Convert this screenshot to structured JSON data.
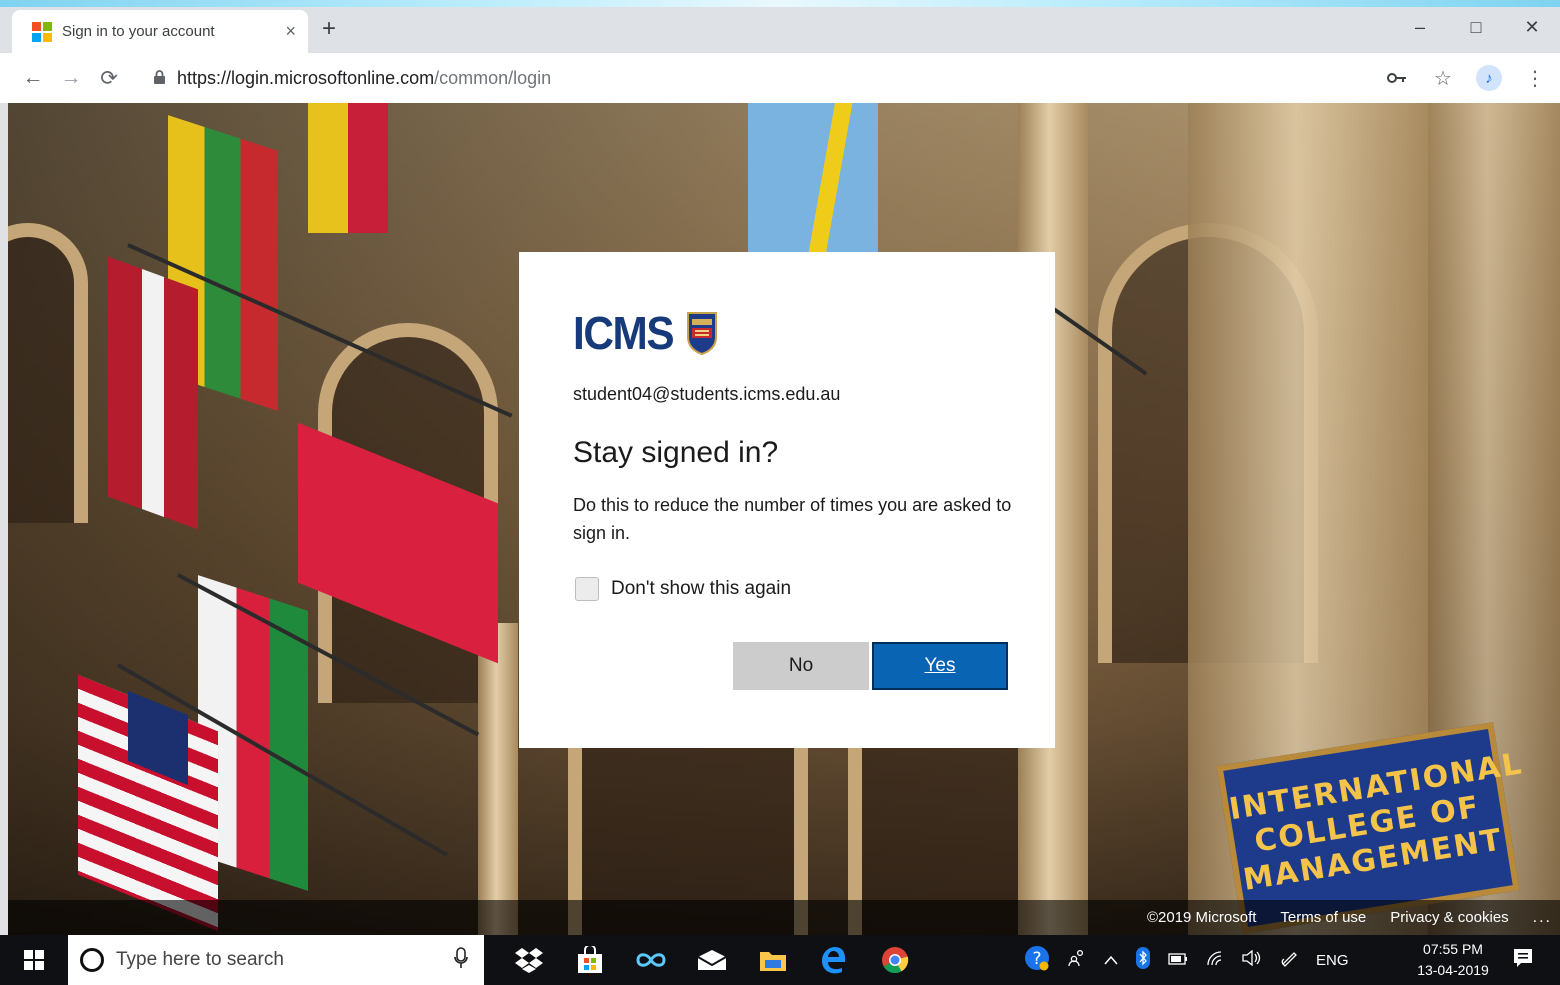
{
  "browser": {
    "tab_title": "Sign in to your account",
    "tab_close": "×",
    "new_tab": "+",
    "window_controls": {
      "minimize": "–",
      "maximize": "□",
      "close": "✕"
    },
    "nav": {
      "back": "←",
      "forward": "→",
      "reload": "⟳"
    },
    "url_host": "https://login.microsoftonline.com",
    "url_path": "/common/login",
    "toolbar_icons": [
      "key-icon",
      "star-icon",
      "profile-icon",
      "menu-icon"
    ],
    "star": "☆",
    "menu": "⋮",
    "key": "⚿",
    "profile_initial": "♪"
  },
  "background": {
    "plaque_text": "INTERNATIONAL COLLEGE OF MANAGEMENT"
  },
  "dialog": {
    "brand": "ICMS",
    "identity": "student04@students.icms.edu.au",
    "heading": "Stay signed in?",
    "description": "Do this to reduce the number of times you are asked to sign in.",
    "checkbox_label": "Don't show this again",
    "checkbox_checked": false,
    "no_label": "No",
    "yes_label": "Yes",
    "accent_color": "#0a64b4"
  },
  "footer": {
    "copyright": "©2019 Microsoft",
    "terms": "Terms of use",
    "privacy": "Privacy & cookies",
    "more": "..."
  },
  "taskbar": {
    "search_placeholder": "Type here to search",
    "apps": [
      "dropbox-icon",
      "store-icon",
      "infinity-icon",
      "mail-icon",
      "file-explorer-icon",
      "edge-icon",
      "chrome-icon"
    ],
    "tray": {
      "language": "ENG",
      "time": "07:55 PM",
      "date": "13-04-2019"
    }
  }
}
